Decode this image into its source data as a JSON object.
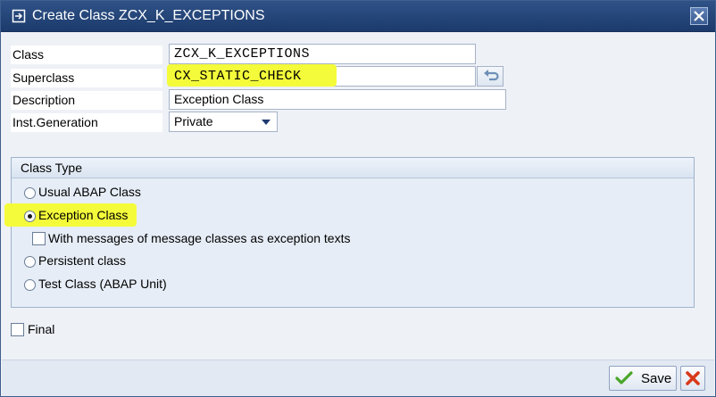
{
  "window": {
    "title": "Create Class ZCX_K_EXCEPTIONS",
    "close_icon": "close-icon"
  },
  "form": {
    "class": {
      "label": "Class",
      "value": "ZCX_K_EXCEPTIONS"
    },
    "superclass": {
      "label": "Superclass",
      "value": "CX_STATIC_CHECK"
    },
    "description": {
      "label": "Description",
      "value": "Exception Class"
    },
    "inst_generation": {
      "label": "Inst.Generation",
      "value": "Private"
    }
  },
  "class_type": {
    "title": "Class Type",
    "options": [
      {
        "label": "Usual ABAP Class",
        "selected": false
      },
      {
        "label": "Exception Class",
        "selected": true
      },
      {
        "label": "With messages of message classes as exception texts",
        "checked": false
      },
      {
        "label": "Persistent class",
        "selected": false
      },
      {
        "label": "Test Class (ABAP Unit)",
        "selected": false
      }
    ]
  },
  "final": {
    "label": "Final",
    "checked": false
  },
  "footer": {
    "save_label": "Save"
  },
  "colors": {
    "highlight": "#f4fb3a",
    "titlebar": "#1c3a6c"
  }
}
